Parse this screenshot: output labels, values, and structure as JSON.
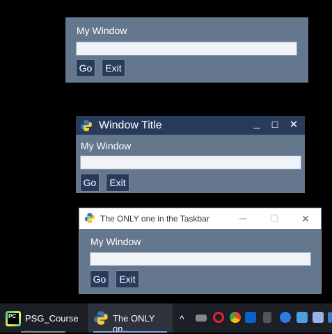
{
  "window1": {
    "label": "My Window",
    "input_value": "",
    "go": "Go",
    "exit": "Exit"
  },
  "window2": {
    "title": "Window Title",
    "label": "My Window",
    "input_value": "",
    "go": "Go",
    "exit": "Exit",
    "min": "_",
    "max": "☐",
    "close": "✕"
  },
  "window3": {
    "title": "The ONLY one in the Taskbar",
    "label": "My Window",
    "input_value": "",
    "go": "Go",
    "exit": "Exit",
    "min": "—",
    "max": "☐",
    "close": "✕"
  },
  "taskbar": {
    "items": [
      {
        "label": "PSG_Course ...",
        "icon": "pycharm-icon"
      },
      {
        "label": "The ONLY on...",
        "icon": "python-icon"
      }
    ],
    "tray_chevron": "^"
  },
  "colors": {
    "window_bg": "#64778d",
    "button_bg": "#283b5b",
    "titlebar_dark": "#283b5b",
    "taskbar": "#1c1f26"
  }
}
